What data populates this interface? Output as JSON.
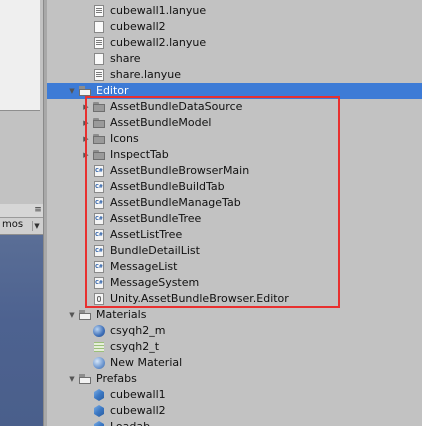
{
  "left_panel": {
    "gizmos_label": "mos",
    "panel_menu_icon": "menu-icon"
  },
  "tree": {
    "rows": [
      {
        "label": "cubewall1.lanyue",
        "icon": "doc-lines-icon",
        "depth": 2,
        "arrow": "none",
        "selected": false
      },
      {
        "label": "cubewall2",
        "icon": "doc-icon",
        "depth": 2,
        "arrow": "none",
        "selected": false
      },
      {
        "label": "cubewall2.lanyue",
        "icon": "doc-lines-icon",
        "depth": 2,
        "arrow": "none",
        "selected": false
      },
      {
        "label": "share",
        "icon": "doc-icon",
        "depth": 2,
        "arrow": "none",
        "selected": false
      },
      {
        "label": "share.lanyue",
        "icon": "doc-lines-icon",
        "depth": 2,
        "arrow": "none",
        "selected": false
      },
      {
        "label": "Editor",
        "icon": "folder-open-icon",
        "depth": 1,
        "arrow": "expanded",
        "selected": true
      },
      {
        "label": "AssetBundleDataSource",
        "icon": "folder-icon",
        "depth": 2,
        "arrow": "collapsed",
        "selected": false
      },
      {
        "label": "AssetBundleModel",
        "icon": "folder-icon",
        "depth": 2,
        "arrow": "collapsed",
        "selected": false
      },
      {
        "label": "Icons",
        "icon": "folder-icon",
        "depth": 2,
        "arrow": "collapsed",
        "selected": false
      },
      {
        "label": "InspectTab",
        "icon": "folder-icon",
        "depth": 2,
        "arrow": "collapsed",
        "selected": false
      },
      {
        "label": "AssetBundleBrowserMain",
        "icon": "cs-icon",
        "depth": 2,
        "arrow": "none",
        "selected": false
      },
      {
        "label": "AssetBundleBuildTab",
        "icon": "cs-icon",
        "depth": 2,
        "arrow": "none",
        "selected": false
      },
      {
        "label": "AssetBundleManageTab",
        "icon": "cs-icon",
        "depth": 2,
        "arrow": "none",
        "selected": false
      },
      {
        "label": "AssetBundleTree",
        "icon": "cs-icon",
        "depth": 2,
        "arrow": "none",
        "selected": false
      },
      {
        "label": "AssetListTree",
        "icon": "cs-icon",
        "depth": 2,
        "arrow": "none",
        "selected": false
      },
      {
        "label": "BundleDetailList",
        "icon": "cs-icon",
        "depth": 2,
        "arrow": "none",
        "selected": false
      },
      {
        "label": "MessageList",
        "icon": "cs-icon",
        "depth": 2,
        "arrow": "none",
        "selected": false
      },
      {
        "label": "MessageSystem",
        "icon": "cs-icon",
        "depth": 2,
        "arrow": "none",
        "selected": false
      },
      {
        "label": "Unity.AssetBundleBrowser.Editor",
        "icon": "asm-icon",
        "depth": 2,
        "arrow": "none",
        "selected": false
      },
      {
        "label": "Materials",
        "icon": "folder-open-icon",
        "depth": 1,
        "arrow": "expanded",
        "selected": false
      },
      {
        "label": "csyqh2_m",
        "icon": "sphere-blue-icon",
        "depth": 2,
        "arrow": "none",
        "selected": false
      },
      {
        "label": "csyqh2_t",
        "icon": "texture-icon",
        "depth": 2,
        "arrow": "none",
        "selected": false
      },
      {
        "label": "New Material",
        "icon": "sphere-blue-light-icon",
        "depth": 2,
        "arrow": "none",
        "selected": false
      },
      {
        "label": "Prefabs",
        "icon": "folder-open-icon",
        "depth": 1,
        "arrow": "expanded",
        "selected": false
      },
      {
        "label": "cubewall1",
        "icon": "cube-icon",
        "depth": 2,
        "arrow": "none",
        "selected": false
      },
      {
        "label": "cubewall2",
        "icon": "cube-icon",
        "depth": 2,
        "arrow": "none",
        "selected": false
      },
      {
        "label": "Loadab",
        "icon": "cube-icon",
        "depth": 2,
        "arrow": "none",
        "selected": false
      }
    ]
  },
  "highlight": {
    "color": "#e8302f"
  },
  "colors": {
    "selection": "#3d7bd6",
    "panel_bg": "#c2c2c2"
  }
}
